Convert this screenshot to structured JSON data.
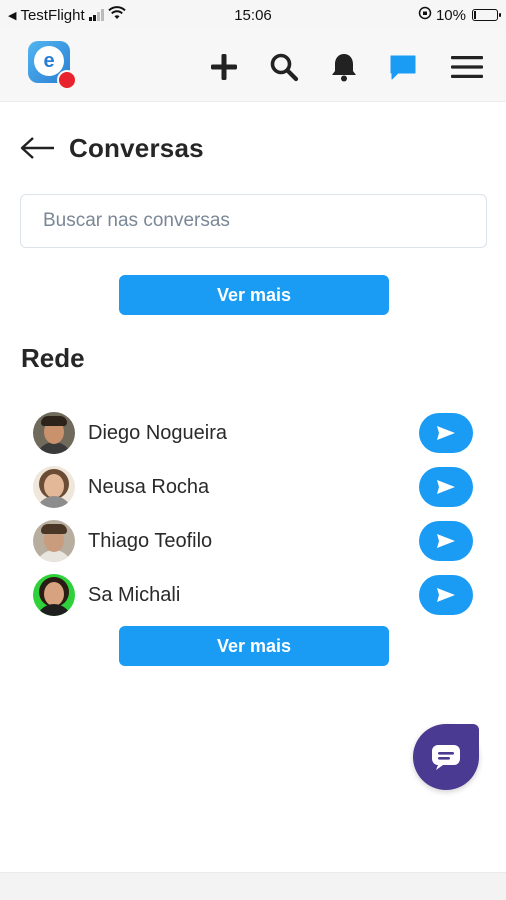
{
  "status_bar": {
    "carrier": "TestFlight",
    "time": "15:06",
    "battery": "10%",
    "battery_level": 0.1
  },
  "header": {
    "logo": "app-logo",
    "icons": [
      "plus-icon",
      "search-icon",
      "bell-icon",
      "chat-icon",
      "menu-icon"
    ],
    "active_color": "#1a9cf5"
  },
  "page": {
    "title": "Conversas"
  },
  "search": {
    "placeholder": "Buscar nas conversas",
    "value": ""
  },
  "conversations": {
    "more_label": "Ver mais"
  },
  "network": {
    "title": "Rede",
    "contacts": [
      {
        "name": "Diego Nogueira"
      },
      {
        "name": "Neusa Rocha"
      },
      {
        "name": "Thiago Teofilo"
      },
      {
        "name": "Sa Michali"
      }
    ],
    "more_label": "Ver mais"
  },
  "colors": {
    "primary": "#1a9cf5",
    "fab": "#4b3a91"
  }
}
